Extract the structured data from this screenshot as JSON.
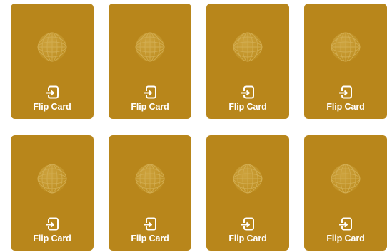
{
  "colors": {
    "card_background": "#b8861b",
    "card_text": "#ffffff",
    "page_background": "#ffffff"
  },
  "cards": [
    {
      "label": "Flip Card",
      "icon": "flip-card-icon",
      "emblem": "globe-icon"
    },
    {
      "label": "Flip Card",
      "icon": "flip-card-icon",
      "emblem": "globe-icon"
    },
    {
      "label": "Flip Card",
      "icon": "flip-card-icon",
      "emblem": "globe-icon"
    },
    {
      "label": "Flip Card",
      "icon": "flip-card-icon",
      "emblem": "globe-icon"
    },
    {
      "label": "Flip Card",
      "icon": "flip-card-icon",
      "emblem": "globe-icon"
    },
    {
      "label": "Flip Card",
      "icon": "flip-card-icon",
      "emblem": "globe-icon"
    },
    {
      "label": "Flip Card",
      "icon": "flip-card-icon",
      "emblem": "globe-icon"
    },
    {
      "label": "Flip Card",
      "icon": "flip-card-icon",
      "emblem": "globe-icon"
    }
  ]
}
